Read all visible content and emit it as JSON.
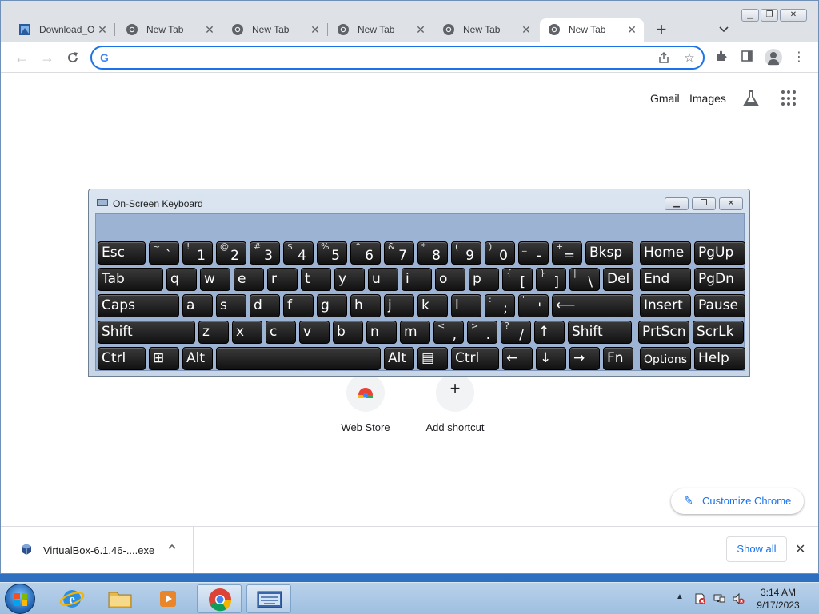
{
  "browser": {
    "tabs": [
      {
        "title": "Download_O",
        "icon": "virtualbox-download-icon"
      },
      {
        "title": "New Tab",
        "icon": "chrome-icon"
      },
      {
        "title": "New Tab",
        "icon": "chrome-icon"
      },
      {
        "title": "New Tab",
        "icon": "chrome-icon"
      },
      {
        "title": "New Tab",
        "icon": "chrome-icon"
      },
      {
        "title": "New Tab",
        "icon": "chrome-icon",
        "active": true
      }
    ],
    "close_glyph": "✕",
    "new_tab_glyph": "+",
    "tab_list_glyph": "⌄",
    "omnibox": {
      "value": "",
      "placeholder": "",
      "provider_glyph": "G"
    },
    "accent_color": "#1a73e8"
  },
  "ntp": {
    "links": [
      "Gmail",
      "Images"
    ],
    "shortcuts": [
      {
        "label": "Web Store",
        "icon": "chrome-web-store-icon"
      },
      {
        "label": "Add shortcut",
        "icon": "plus-icon",
        "glyph": "+"
      }
    ],
    "customize_label": "Customize Chrome"
  },
  "downloads": {
    "item_name": "VirtualBox-6.1.46-....exe",
    "show_all_label": "Show all"
  },
  "osk": {
    "title": "On-Screen Keyboard",
    "rows": [
      [
        {
          "m": "Esc"
        },
        {
          "s": "~",
          "b": "`"
        },
        {
          "s": "!",
          "b": "1"
        },
        {
          "s": "@",
          "b": "2"
        },
        {
          "s": "#",
          "b": "3"
        },
        {
          "s": "$",
          "b": "4"
        },
        {
          "s": "%",
          "b": "5"
        },
        {
          "s": "^",
          "b": "6"
        },
        {
          "s": "&",
          "b": "7"
        },
        {
          "s": "*",
          "b": "8"
        },
        {
          "s": "(",
          "b": "9"
        },
        {
          "s": ")",
          "b": "0"
        },
        {
          "s": "_",
          "b": "-"
        },
        {
          "s": "+",
          "b": "="
        },
        {
          "m": "Bksp"
        },
        {
          "m": "Home"
        },
        {
          "m": "PgUp"
        }
      ],
      [
        {
          "m": "Tab"
        },
        {
          "m": "q"
        },
        {
          "m": "w"
        },
        {
          "m": "e"
        },
        {
          "m": "r"
        },
        {
          "m": "t"
        },
        {
          "m": "y"
        },
        {
          "m": "u"
        },
        {
          "m": "i"
        },
        {
          "m": "o"
        },
        {
          "m": "p"
        },
        {
          "s": "{",
          "b": "["
        },
        {
          "s": "}",
          "b": "]"
        },
        {
          "s": "|",
          "b": "\\"
        },
        {
          "m": "Del"
        },
        {
          "m": "End"
        },
        {
          "m": "PgDn"
        }
      ],
      [
        {
          "m": "Caps"
        },
        {
          "m": "a"
        },
        {
          "m": "s"
        },
        {
          "m": "d"
        },
        {
          "m": "f"
        },
        {
          "m": "g"
        },
        {
          "m": "h"
        },
        {
          "m": "j"
        },
        {
          "m": "k"
        },
        {
          "m": "l"
        },
        {
          "s": ":",
          "b": ";"
        },
        {
          "s": "\"",
          "b": "'"
        },
        {
          "m": "⟵"
        },
        {
          "m": "Insert"
        },
        {
          "m": "Pause"
        }
      ],
      [
        {
          "m": "Shift"
        },
        {
          "m": "z"
        },
        {
          "m": "x"
        },
        {
          "m": "c"
        },
        {
          "m": "v"
        },
        {
          "m": "b"
        },
        {
          "m": "n"
        },
        {
          "m": "m"
        },
        {
          "s": "<",
          "b": ","
        },
        {
          "s": ">",
          "b": "."
        },
        {
          "s": "?",
          "b": "/"
        },
        {
          "m": "↑"
        },
        {
          "m": "Shift"
        },
        {
          "m": "PrtScn"
        },
        {
          "m": "ScrLk"
        }
      ],
      [
        {
          "m": "Ctrl"
        },
        {
          "m": "⊞"
        },
        {
          "m": "Alt"
        },
        {
          "m": ""
        },
        {
          "m": "Alt"
        },
        {
          "m": "▤"
        },
        {
          "m": "Ctrl"
        },
        {
          "m": "←"
        },
        {
          "m": "↓"
        },
        {
          "m": "→"
        },
        {
          "m": "Fn"
        },
        {
          "m": "Options"
        },
        {
          "m": "Help"
        }
      ]
    ]
  },
  "taskbar": {
    "apps": [
      "internet-explorer-icon",
      "file-explorer-icon",
      "media-player-icon",
      "chrome-icon",
      "on-screen-keyboard-icon"
    ],
    "time": "3:14 AM",
    "date": "9/17/2023",
    "tray_arrow": "▲"
  }
}
